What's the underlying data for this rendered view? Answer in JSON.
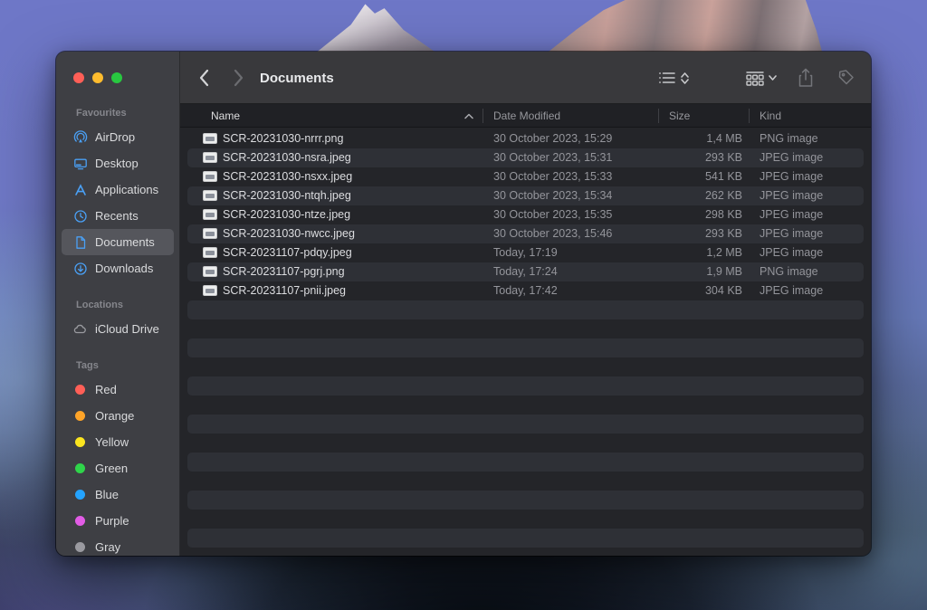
{
  "window": {
    "title": "Documents",
    "traffic_lights": {
      "close": "#ff5f57",
      "minimize": "#febc2e",
      "zoom": "#28c840"
    }
  },
  "toolbar": {
    "back_icon": "chevron-left",
    "forward_icon": "chevron-right",
    "view_control": "list-view with sort chevrons",
    "group_control": "group-by grid with chevron",
    "share": "share-icon (disabled)",
    "tag": "tag-icon (disabled)",
    "more": "ellipsis-circle with chevron",
    "search": "magnifier-icon"
  },
  "sidebar": {
    "favourites": {
      "label": "Favourites",
      "items": [
        {
          "label": "AirDrop"
        },
        {
          "label": "Desktop"
        },
        {
          "label": "Applications"
        },
        {
          "label": "Recents"
        },
        {
          "label": "Documents",
          "selected": true
        },
        {
          "label": "Downloads"
        }
      ]
    },
    "locations": {
      "label": "Locations",
      "items": [
        {
          "label": "iCloud Drive"
        }
      ]
    },
    "tags": {
      "label": "Tags",
      "items": [
        {
          "label": "Red",
          "color": "#ff5f57"
        },
        {
          "label": "Orange",
          "color": "#ffa428"
        },
        {
          "label": "Yellow",
          "color": "#fbe51f"
        },
        {
          "label": "Green",
          "color": "#2fd44a"
        },
        {
          "label": "Blue",
          "color": "#24a3ff"
        },
        {
          "label": "Purple",
          "color": "#e25ce6"
        },
        {
          "label": "Gray",
          "color": "#9a9aa0"
        }
      ]
    },
    "accent_color": "#4aa0f5"
  },
  "list": {
    "columns": {
      "name": "Name",
      "date": "Date Modified",
      "size": "Size",
      "kind": "Kind"
    },
    "sort_column": "Name",
    "sort_direction": "ascending",
    "files": [
      {
        "name": "SCR-20231030-nrrr.png",
        "modified": "30 October 2023, 15:29",
        "size": "1,4 MB",
        "kind": "PNG image"
      },
      {
        "name": "SCR-20231030-nsra.jpeg",
        "modified": "30 October 2023, 15:31",
        "size": "293 KB",
        "kind": "JPEG image"
      },
      {
        "name": "SCR-20231030-nsxx.jpeg",
        "modified": "30 October 2023, 15:33",
        "size": "541 KB",
        "kind": "JPEG image"
      },
      {
        "name": "SCR-20231030-ntqh.jpeg",
        "modified": "30 October 2023, 15:34",
        "size": "262 KB",
        "kind": "JPEG image"
      },
      {
        "name": "SCR-20231030-ntze.jpeg",
        "modified": "30 October 2023, 15:35",
        "size": "298 KB",
        "kind": "JPEG image"
      },
      {
        "name": "SCR-20231030-nwcc.jpeg",
        "modified": "30 October 2023, 15:46",
        "size": "293 KB",
        "kind": "JPEG image"
      },
      {
        "name": "SCR-20231107-pdqy.jpeg",
        "modified": "Today, 17:19",
        "size": "1,2 MB",
        "kind": "JPEG image"
      },
      {
        "name": "SCR-20231107-pgrj.png",
        "modified": "Today, 17:24",
        "size": "1,9 MB",
        "kind": "PNG image"
      },
      {
        "name": "SCR-20231107-pnii.jpeg",
        "modified": "Today, 17:42",
        "size": "304 KB",
        "kind": "JPEG image"
      }
    ]
  }
}
